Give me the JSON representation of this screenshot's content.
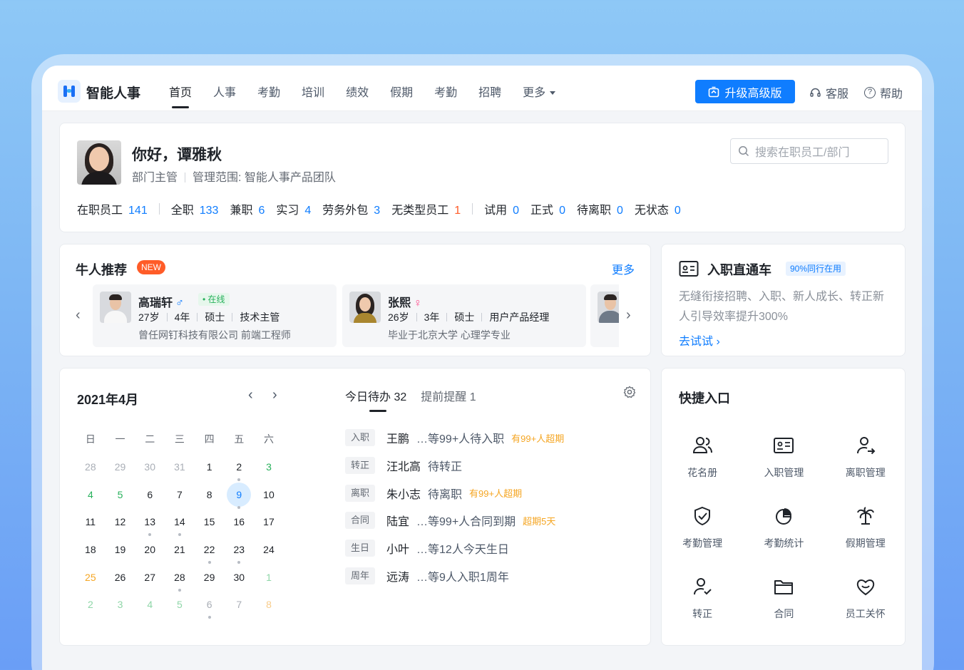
{
  "app": {
    "name": "智能人事"
  },
  "nav": [
    {
      "label": "首页",
      "active": true
    },
    {
      "label": "人事"
    },
    {
      "label": "考勤"
    },
    {
      "label": "培训"
    },
    {
      "label": "绩效"
    },
    {
      "label": "假期"
    },
    {
      "label": "考勤"
    },
    {
      "label": "招聘"
    },
    {
      "label": "更多"
    }
  ],
  "header": {
    "upgrade_label": "升级高级版",
    "service_label": "客服",
    "help_label": "帮助"
  },
  "welcome": {
    "greeting": "你好，谭雅秋",
    "role": "部门主管",
    "scope": "管理范围: 智能人事产品团队",
    "search_placeholder": "搜索在职员工/部门",
    "stats": [
      {
        "label": "在职员工",
        "value": "141"
      },
      {
        "label": "全职",
        "value": "133"
      },
      {
        "label": "兼职",
        "value": "6"
      },
      {
        "label": "实习",
        "value": "4"
      },
      {
        "label": "劳务外包",
        "value": "3"
      },
      {
        "label": "无类型员工",
        "value": "1",
        "highlight": "orange"
      },
      {
        "label": "试用",
        "value": "0"
      },
      {
        "label": "正式",
        "value": "0"
      },
      {
        "label": "待离职",
        "value": "0"
      },
      {
        "label": "无状态",
        "value": "0"
      }
    ]
  },
  "talent": {
    "title": "牛人推荐",
    "badge": "NEW",
    "more_label": "更多",
    "people": [
      {
        "name": "高瑞轩",
        "gender": "♂",
        "status": "• 在线",
        "age": "27岁",
        "years": "4年",
        "degree": "硕士",
        "position": "技术主管",
        "desc": "曾任网钉科技有限公司 前端工程师"
      },
      {
        "name": "张熙",
        "gender": "♀",
        "age": "26岁",
        "years": "3年",
        "degree": "硕士",
        "position": "用户产品经理",
        "desc": "毕业于北京大学 心理学专业"
      }
    ]
  },
  "onboard": {
    "title": "入职直通车",
    "tag": "90%同行在用",
    "desc": "无缝衔接招聘、入职、新人成长、转正新人引导效率提升300%",
    "try_label": "去试试"
  },
  "calendar": {
    "title": "2021年4月",
    "weekdays": [
      "日",
      "一",
      "二",
      "三",
      "四",
      "五",
      "六"
    ],
    "weeks": [
      [
        {
          "d": "28",
          "c": "gray"
        },
        {
          "d": "29",
          "c": "gray"
        },
        {
          "d": "30",
          "c": "gray"
        },
        {
          "d": "31",
          "c": "gray"
        },
        {
          "d": "1"
        },
        {
          "d": "2",
          "dot": true
        },
        {
          "d": "3",
          "c": "green"
        }
      ],
      [
        {
          "d": "4",
          "c": "green"
        },
        {
          "d": "5",
          "c": "green"
        },
        {
          "d": "6"
        },
        {
          "d": "7"
        },
        {
          "d": "8"
        },
        {
          "d": "9",
          "today": true,
          "dot": true
        },
        {
          "d": "10"
        }
      ],
      [
        {
          "d": "11"
        },
        {
          "d": "12"
        },
        {
          "d": "13",
          "dot": true
        },
        {
          "d": "14",
          "dot": true
        },
        {
          "d": "15"
        },
        {
          "d": "16"
        },
        {
          "d": "17"
        }
      ],
      [
        {
          "d": "18"
        },
        {
          "d": "19"
        },
        {
          "d": "20"
        },
        {
          "d": "21"
        },
        {
          "d": "22",
          "dot": true
        },
        {
          "d": "23",
          "dot": true
        },
        {
          "d": "24"
        }
      ],
      [
        {
          "d": "25",
          "c": "orange"
        },
        {
          "d": "26"
        },
        {
          "d": "27"
        },
        {
          "d": "28",
          "dot": true
        },
        {
          "d": "29"
        },
        {
          "d": "30"
        },
        {
          "d": "1",
          "c": "lgreen"
        }
      ],
      [
        {
          "d": "2",
          "c": "lgreen"
        },
        {
          "d": "3",
          "c": "lgreen"
        },
        {
          "d": "4",
          "c": "lgreen"
        },
        {
          "d": "5",
          "c": "lgreen"
        },
        {
          "d": "6",
          "c": "gray",
          "dot": true
        },
        {
          "d": "7",
          "c": "gray"
        },
        {
          "d": "8",
          "c": "lorange"
        }
      ]
    ]
  },
  "todo": {
    "tabs": [
      {
        "label": "今日待办 32",
        "active": true
      },
      {
        "label": "提前提醒 1"
      }
    ],
    "items": [
      {
        "tag": "入职",
        "name": "王鹏",
        "desc": "…等99+人待入职",
        "warn": "有99+人超期"
      },
      {
        "tag": "转正",
        "name": "汪北高",
        "desc": "待转正",
        "warn": ""
      },
      {
        "tag": "离职",
        "name": "朱小志",
        "desc": "待离职",
        "warn": "有99+人超期"
      },
      {
        "tag": "合同",
        "name": "陆宜",
        "desc": "…等99+人合同到期",
        "warn": "超期5天"
      },
      {
        "tag": "生日",
        "name": "小叶",
        "desc": "…等12人今天生日",
        "warn": ""
      },
      {
        "tag": "周年",
        "name": "远涛",
        "desc": "…等9人入职1周年",
        "warn": ""
      }
    ]
  },
  "quick": {
    "title": "快捷入口",
    "items": [
      {
        "label": "花名册",
        "icon": "users-icon"
      },
      {
        "label": "入职管理",
        "icon": "id-card-icon"
      },
      {
        "label": "离职管理",
        "icon": "user-exit-icon"
      },
      {
        "label": "考勤管理",
        "icon": "shield-check-icon"
      },
      {
        "label": "考勤统计",
        "icon": "pie-chart-icon"
      },
      {
        "label": "假期管理",
        "icon": "palm-tree-icon"
      },
      {
        "label": "转正",
        "icon": "user-check-icon"
      },
      {
        "label": "合同",
        "icon": "folder-icon"
      },
      {
        "label": "员工关怀",
        "icon": "heart-icon"
      }
    ]
  },
  "colors": {
    "accent": "#0f7dff",
    "warning": "#f5a623",
    "highlight": "#ff5c28"
  }
}
